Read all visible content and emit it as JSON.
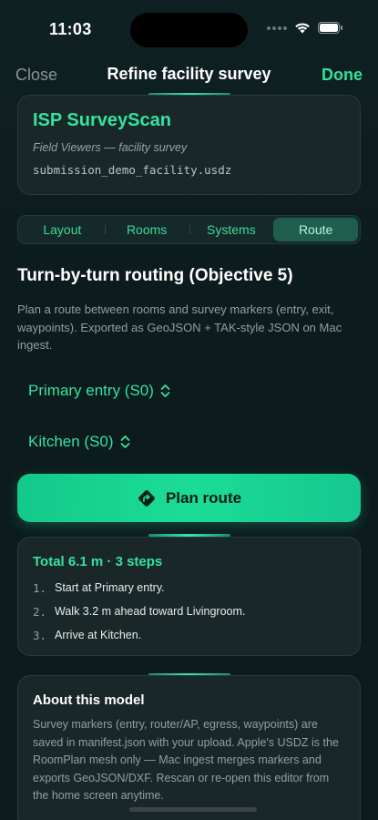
{
  "status": {
    "time": "11:03"
  },
  "nav": {
    "close_label": "Close",
    "title": "Refine facility survey",
    "done_label": "Done"
  },
  "header": {
    "title": "ISP SurveyScan",
    "subtitle": "Field Viewers — facility survey",
    "filename": "submission_demo_facility.usdz"
  },
  "tabs": [
    {
      "label": "Layout",
      "active": false
    },
    {
      "label": "Rooms",
      "active": false
    },
    {
      "label": "Systems",
      "active": false
    },
    {
      "label": "Route",
      "active": true
    }
  ],
  "section": {
    "title": "Turn-by-turn routing (Objective 5)",
    "description": "Plan a route between rooms and survey markers (entry, exit, waypoints). Exported as GeoJSON + TAK-style JSON on Mac ingest."
  },
  "pickers": {
    "from": "Primary entry (S0)",
    "to": "Kitchen (S0)"
  },
  "plan_button": {
    "label": "Plan route"
  },
  "route": {
    "total": "Total 6.1 m · 3 steps",
    "steps": [
      {
        "num": "1.",
        "text": "Start at Primary entry."
      },
      {
        "num": "2.",
        "text": "Walk 3.2 m ahead toward Livingroom."
      },
      {
        "num": "3.",
        "text": "Arrive at Kitchen."
      }
    ]
  },
  "about": {
    "title": "About this model",
    "body": "Survey markers (entry, router/AP, egress, waypoints) are saved in manifest.json with your upload. Apple's USDZ is the RoomPlan mesh only — Mac ingest merges markers and exports GeoJSON/DXF. Rescan or re-open this editor from the home screen anytime."
  },
  "colors": {
    "accent": "#34e39e",
    "button": "#1bdc97",
    "card": "#1a2729"
  }
}
